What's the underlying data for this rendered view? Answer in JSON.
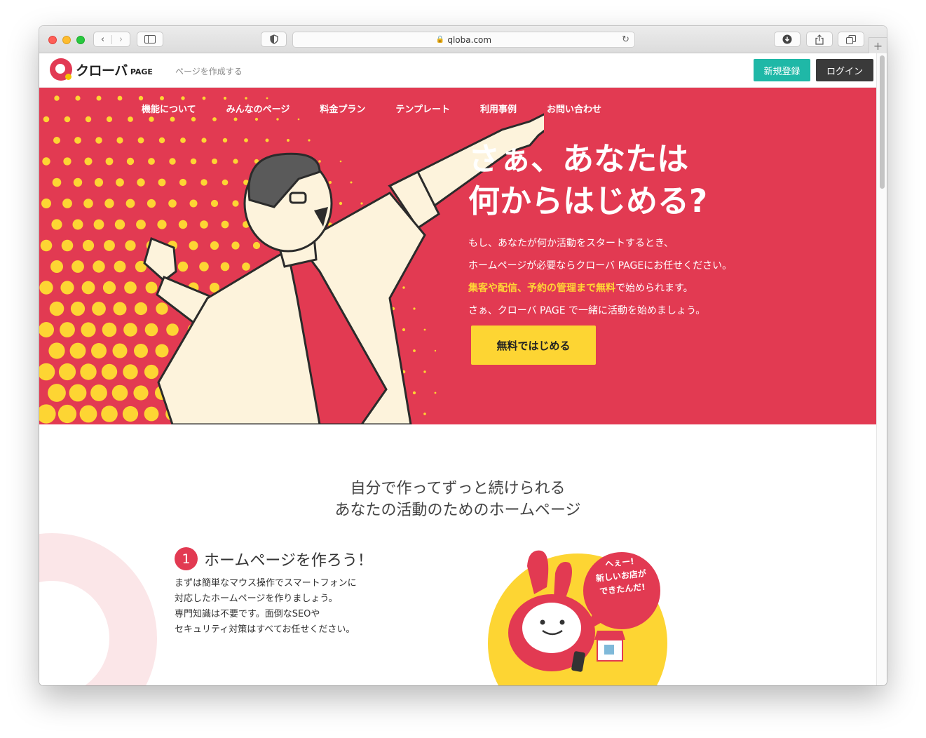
{
  "browser": {
    "url": "qloba.com",
    "buttons": {
      "back": "‹",
      "forward": "›",
      "new_tab": "+"
    }
  },
  "header": {
    "logo_text": "クローバ",
    "logo_sub": "PAGE",
    "tagline": "ページを作成する",
    "signup_label": "新規登録",
    "login_label": "ログイン"
  },
  "hero": {
    "nav": [
      "機能について",
      "みんなのページ",
      "料金プラン",
      "テンプレート",
      "利用事例",
      "お問い合わせ"
    ],
    "title_line1": "さぁ、あなたは",
    "title_line2": "何からはじめる?",
    "line1": "もし、あなたが何か活動をスタートするとき、",
    "line2": "ホームページが必要ならクローバ PAGEにお任せください。",
    "line3_highlight": "集客や配信、予約の管理まで無料",
    "line3_rest": "で始められます。",
    "line4": "さぁ、クローバ PAGE で一緒に活動を始めましょう。",
    "cta_label": "無料ではじめる",
    "colors": {
      "background": "#e23a52",
      "dots": "#fdd533",
      "cta": "#fdd533"
    }
  },
  "section": {
    "heading_line1": "自分で作ってずっと続けられる",
    "heading_line2": "あなたの活動のためのホームページ",
    "step_number": "1",
    "step_title": "ホームページを作ろう！",
    "body_line1": "まずは簡単なマウス操作でスマートフォンに",
    "body_line2": "対応したホームページを作りましょう。",
    "body_line3": "専門知識は不要です。面倒なSEOや",
    "body_line4": "セキュリティ対策はすべてお任せください。",
    "bubble_line1": "へぇー!",
    "bubble_line2": "新しいお店が",
    "bubble_line3": "できたんだ!"
  },
  "colors": {
    "accent": "#e23a52",
    "signup": "#1fb8a7",
    "login": "#3a3a3a"
  }
}
